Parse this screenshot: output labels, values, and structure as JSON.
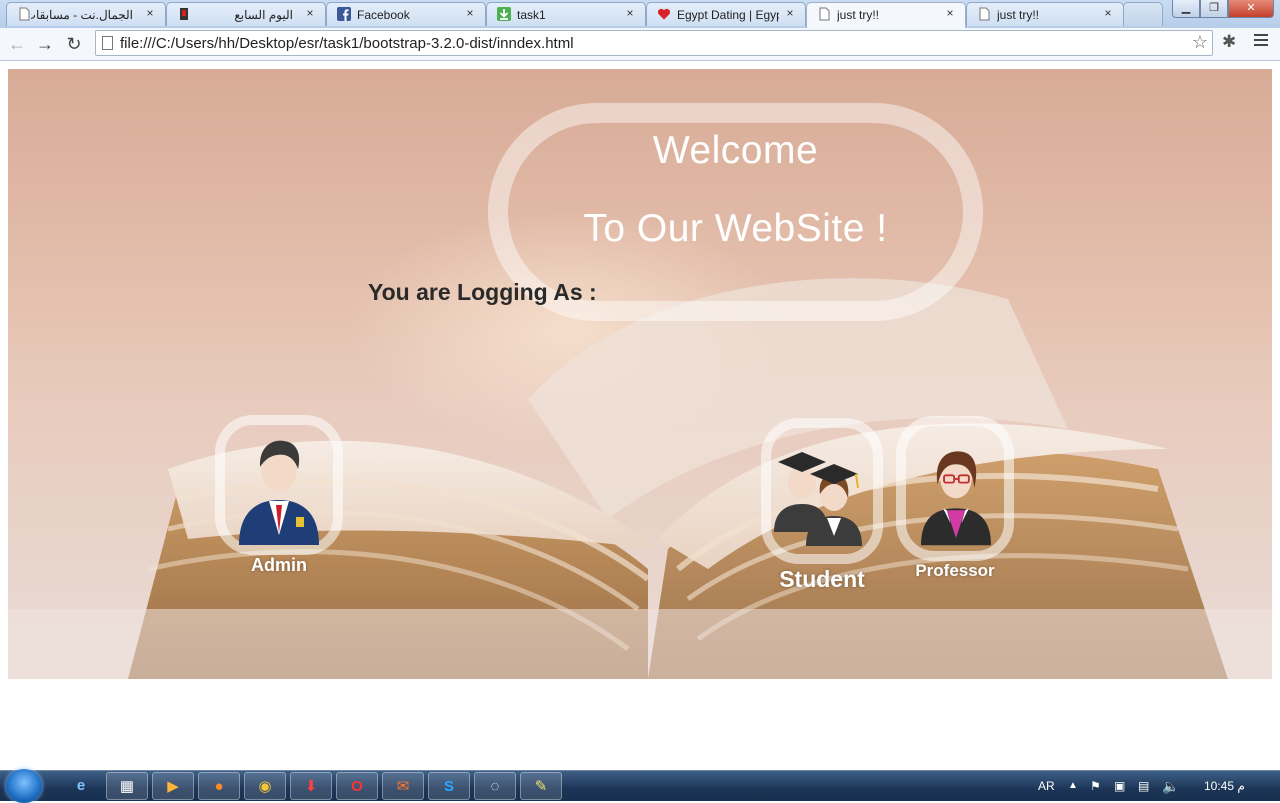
{
  "browser": {
    "tabs": [
      {
        "title": "الجمال.نت - مسابقات",
        "icon": "page-icon",
        "rtl": true
      },
      {
        "title": "اليوم السابع",
        "icon": "site-icon",
        "rtl": true
      },
      {
        "title": "Facebook",
        "icon": "facebook-icon",
        "rtl": false
      },
      {
        "title": "task1",
        "icon": "download-icon",
        "rtl": false
      },
      {
        "title": "Egypt Dating | Egyp",
        "icon": "heart-icon",
        "rtl": false
      },
      {
        "title": "just try!!",
        "icon": "page-icon",
        "rtl": false
      },
      {
        "title": "just try!!",
        "icon": "page-icon",
        "rtl": false
      }
    ],
    "tab_close_glyph": "×",
    "address": "file:///C:/Users/hh/Desktop/esr/task1/bootstrap-3.2.0-dist/inndex.html"
  },
  "page": {
    "welcome_line1": "Welcome",
    "welcome_line2": "To Our WebSite !",
    "logging_label": "You are Logging As :",
    "roles": {
      "admin": "Admin",
      "student": "Student",
      "professor": "Professor"
    }
  },
  "taskbar": {
    "language": "AR",
    "clock": "10:45 م"
  },
  "colors": {
    "page_bg": "#d9b09c",
    "heading_text": "#2a2a2a",
    "welcome_text": "#ffffff"
  }
}
